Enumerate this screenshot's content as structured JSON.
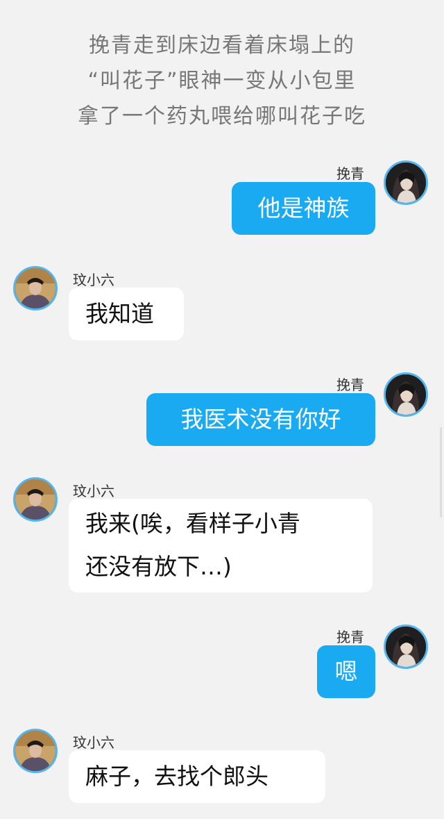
{
  "narration": {
    "lines": [
      "挽青走到床边看着床塌上的",
      "“叫花子”眼神一变从小包里",
      "拿了一个药丸喂给哪叫花子吃"
    ]
  },
  "messages": [
    {
      "side": "right",
      "sender": "挽青",
      "avatar": "wanqing-avatar",
      "lines": [
        "他是神族"
      ]
    },
    {
      "side": "left",
      "sender": "玟小六",
      "avatar": "xiaoliu-avatar",
      "lines": [
        "我知道"
      ]
    },
    {
      "side": "right",
      "sender": "挽青",
      "avatar": "wanqing-avatar",
      "lines": [
        "我医术没有你好"
      ]
    },
    {
      "side": "left",
      "sender": "玟小六",
      "avatar": "xiaoliu-avatar",
      "lines": [
        "我来(唉，看样子小青",
        "还没有放下…)"
      ]
    },
    {
      "side": "right",
      "sender": "挽青",
      "avatar": "wanqing-avatar",
      "lines": [
        "嗯"
      ]
    },
    {
      "side": "left",
      "sender": "玟小六",
      "avatar": "xiaoliu-avatar",
      "lines": [
        "麻子，去找个郎头"
      ]
    }
  ],
  "colors": {
    "background": "#f2f2f2",
    "outgoing_bubble": "#1aaaf2",
    "incoming_bubble": "#ffffff",
    "avatar_ring": "#55b6ee",
    "narration_text": "#777777"
  }
}
